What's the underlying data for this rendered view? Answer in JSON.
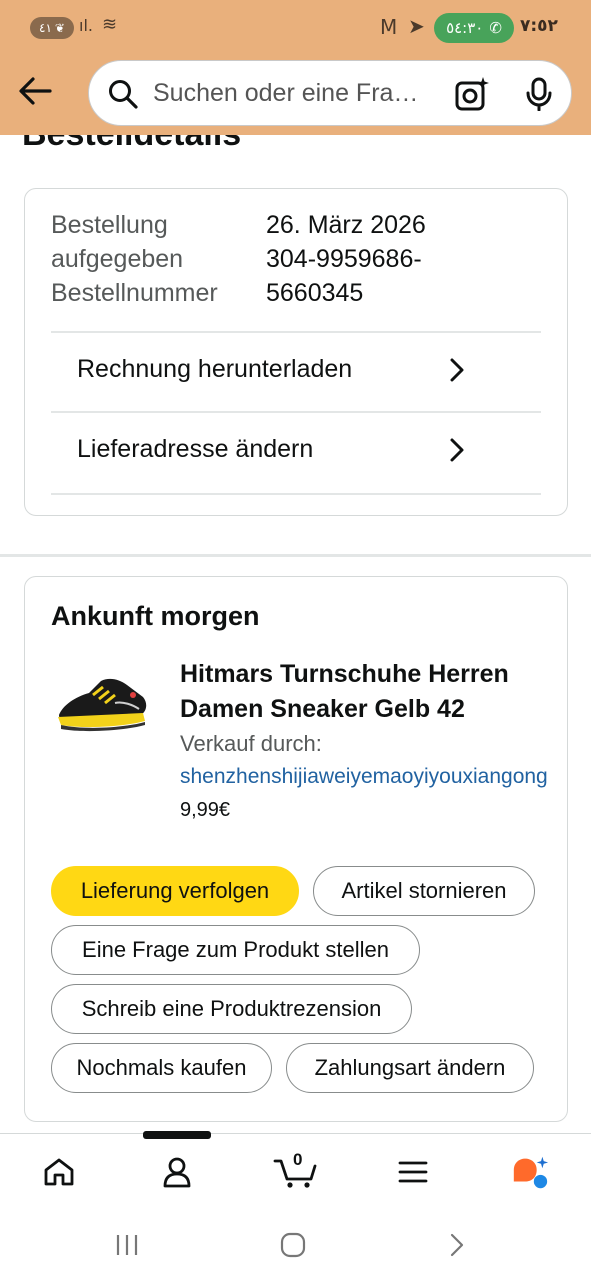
{
  "status_bar": {
    "battery": "٤١",
    "call_time": "٥٤:٣٠",
    "clock": "٧:٥٢"
  },
  "search": {
    "placeholder": "Suchen oder eine Fra…"
  },
  "page": {
    "title": "Bestelldetails"
  },
  "order": {
    "placed_label": "Bestellung aufgegeben",
    "placed_label_line1": "Bestellung",
    "placed_label_line2": "aufgegeben",
    "placed_value": "26. März 2026",
    "number_label": "Bestellnummer",
    "number_value_line1": "304-9959686-",
    "number_value_line2": "5660345",
    "links": [
      {
        "label": "Rechnung herunterladen"
      },
      {
        "label": "Lieferadresse ändern"
      }
    ]
  },
  "shipment": {
    "status": "Ankunft morgen",
    "product_title": "Hitmars Turnschuhe Herren Damen Sneaker Gelb 42",
    "sold_by_label": "Verkauf durch:",
    "seller": "shenzhenshijiaweiyemaoyiyouxiangong",
    "price": "9,99€",
    "actions": [
      "Lieferung verfolgen",
      "Artikel stornieren",
      "Eine Frage zum Produkt stellen",
      "Schreib eine Produktrezension",
      "Nochmals kaufen",
      "Zahlungsart ändern"
    ]
  },
  "nav": {
    "cart_count": "0",
    "items": [
      "home-icon",
      "account-icon",
      "cart-icon",
      "menu-icon",
      "rufus-icon"
    ]
  },
  "colors": {
    "header": "#e9b07c",
    "primary_button": "#ffd814",
    "link": "#2162a1"
  }
}
